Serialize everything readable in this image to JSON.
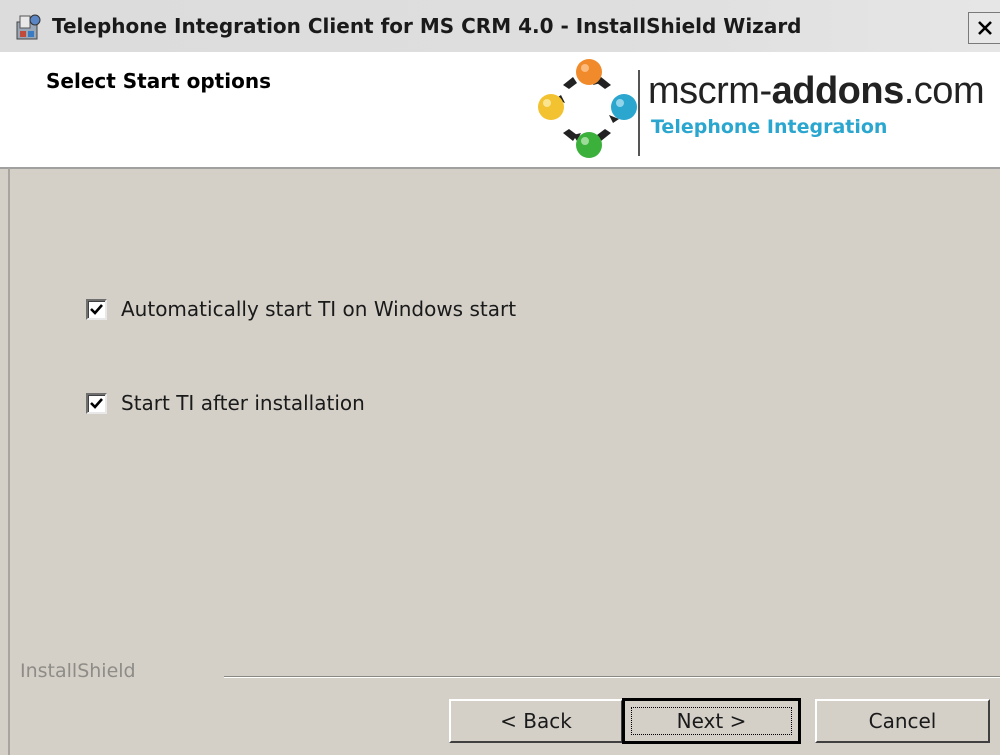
{
  "window": {
    "title": "Telephone Integration Client for MS CRM 4.0 - InstallShield Wizard",
    "close_icon": "close-icon"
  },
  "banner": {
    "title": "Select Start options",
    "logo_text_plain": "mscrm-",
    "logo_text_bold": "addons",
    "logo_text_suffix": ".com",
    "logo_subtitle": "Telephone Integration"
  },
  "options": [
    {
      "label": "Automatically start TI on Windows start",
      "checked": true
    },
    {
      "label": "Start TI after installation",
      "checked": true
    }
  ],
  "footer": {
    "brand": "InstallShield",
    "back_label": "< Back",
    "next_label": "Next >",
    "cancel_label": "Cancel"
  },
  "colors": {
    "dialog_bg": "#d4d0c8",
    "subtitle_blue": "#2aa6cf",
    "logo_orange": "#f08a2a",
    "logo_blue": "#2aa6cf",
    "logo_green": "#3bb03b",
    "logo_yellow": "#f2c230"
  }
}
